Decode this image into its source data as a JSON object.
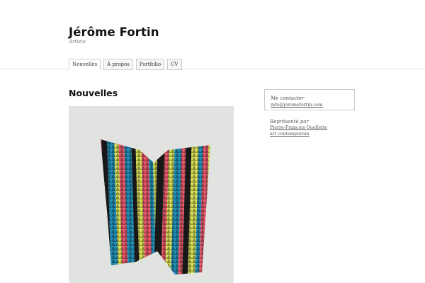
{
  "site": {
    "title": "Jérôme Fortin",
    "description": "Artiste"
  },
  "nav": {
    "items": [
      {
        "label": "Nouvelles",
        "active": true
      },
      {
        "label": "À propos",
        "active": false
      },
      {
        "label": "Portfolio",
        "active": false
      },
      {
        "label": "CV",
        "active": false
      }
    ]
  },
  "main": {
    "title": "Nouvelles"
  },
  "sidebar": {
    "contact": {
      "title": "Me contacter",
      "email": "info@jeromefortin.com"
    },
    "represented": {
      "title": "Représenté par",
      "line1": "Pierre-François Ouellette",
      "line2": "art contemporain"
    }
  },
  "colors": {
    "stripe_palette": [
      "#e8576a",
      "#1f8fb8",
      "#d9e055",
      "#1a1a1a",
      "#f2f2f2"
    ]
  }
}
